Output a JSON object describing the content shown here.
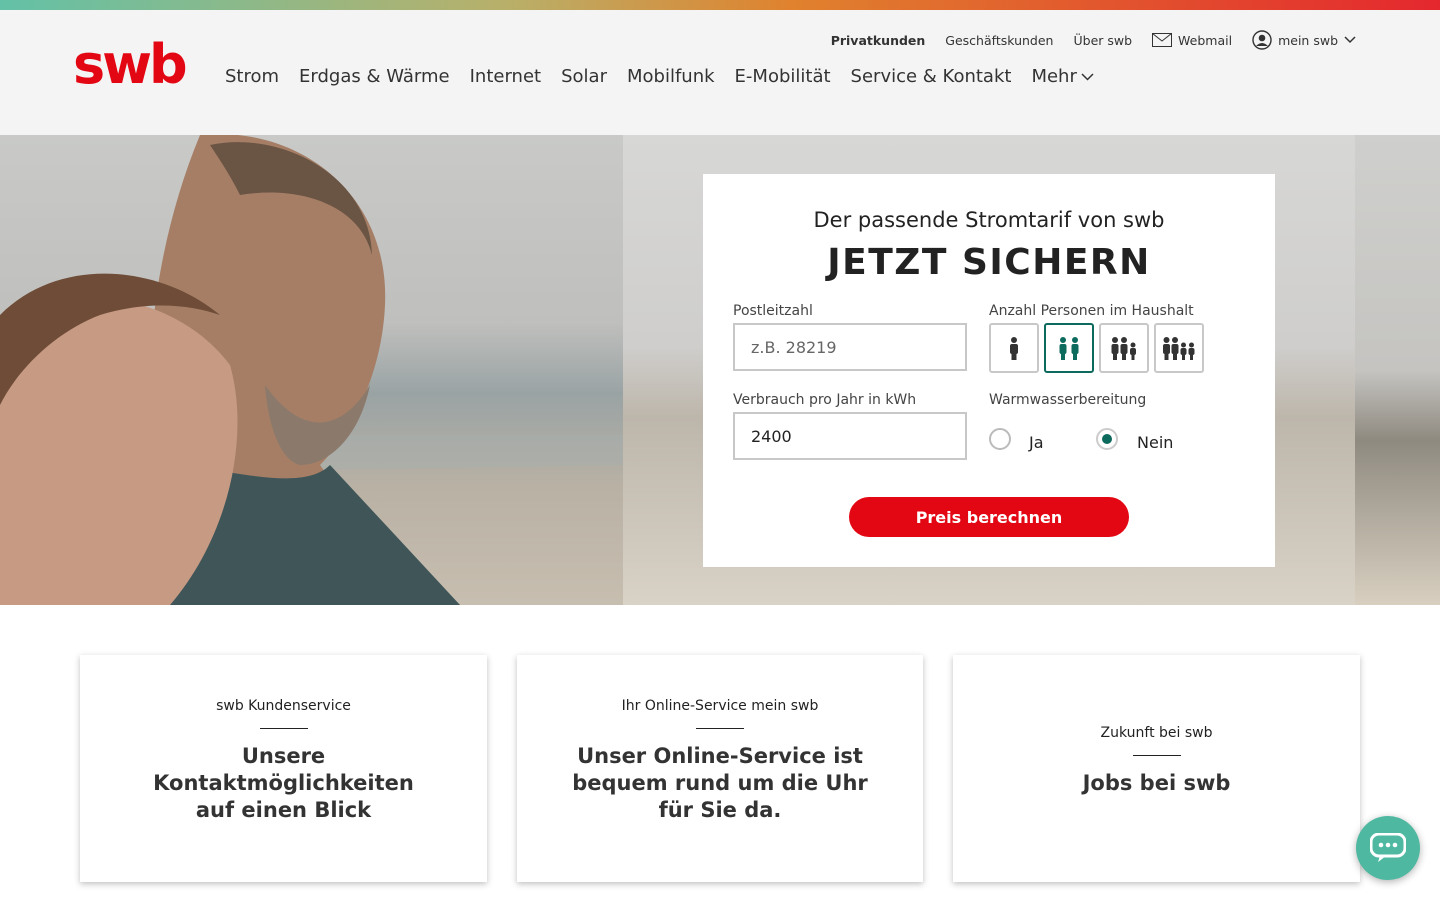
{
  "brand": {
    "logo_text": "swb",
    "color": "#e30613",
    "accent": "#0d6b5e"
  },
  "meta_nav": {
    "privatkunden": "Privatkunden",
    "geschaeftskunden": "Geschäftskunden",
    "ueber": "Über swb",
    "webmail": "Webmail",
    "mein_swb": "mein swb"
  },
  "main_nav": [
    "Strom",
    "Erdgas & Wärme",
    "Internet",
    "Solar",
    "Mobilfunk",
    "E-Mobilität",
    "Service & Kontakt",
    "Mehr"
  ],
  "tariff_form": {
    "subtitle": "Der passende Stromtarif von swb",
    "headline": "JETZT SICHERN",
    "postcode_label": "Postleitzahl",
    "postcode_placeholder": "z.B. 28219",
    "persons_label": "Anzahl Personen im Haushalt",
    "persons_selected": 2,
    "consumption_label": "Verbrauch pro Jahr in kWh",
    "consumption_value": "2400",
    "warmwater_label": "Warmwasserbereitung",
    "warmwater_yes": "Ja",
    "warmwater_no": "Nein",
    "warmwater_selected": "Nein",
    "submit": "Preis berechnen"
  },
  "teasers": [
    {
      "kicker": "swb Kundenservice",
      "title": "Unsere Kontaktmöglichkeiten auf einen Blick"
    },
    {
      "kicker": "Ihr Online-Service mein swb",
      "title": "Unser Online-Service ist bequem rund um die Uhr für Sie da."
    },
    {
      "kicker": "Zukunft bei swb",
      "title": "Jobs bei swb"
    }
  ],
  "icons": {
    "webmail": "envelope-icon",
    "account": "user-circle-icon",
    "chevron": "chevron-down-icon",
    "chat": "chat-bubble-icon"
  }
}
